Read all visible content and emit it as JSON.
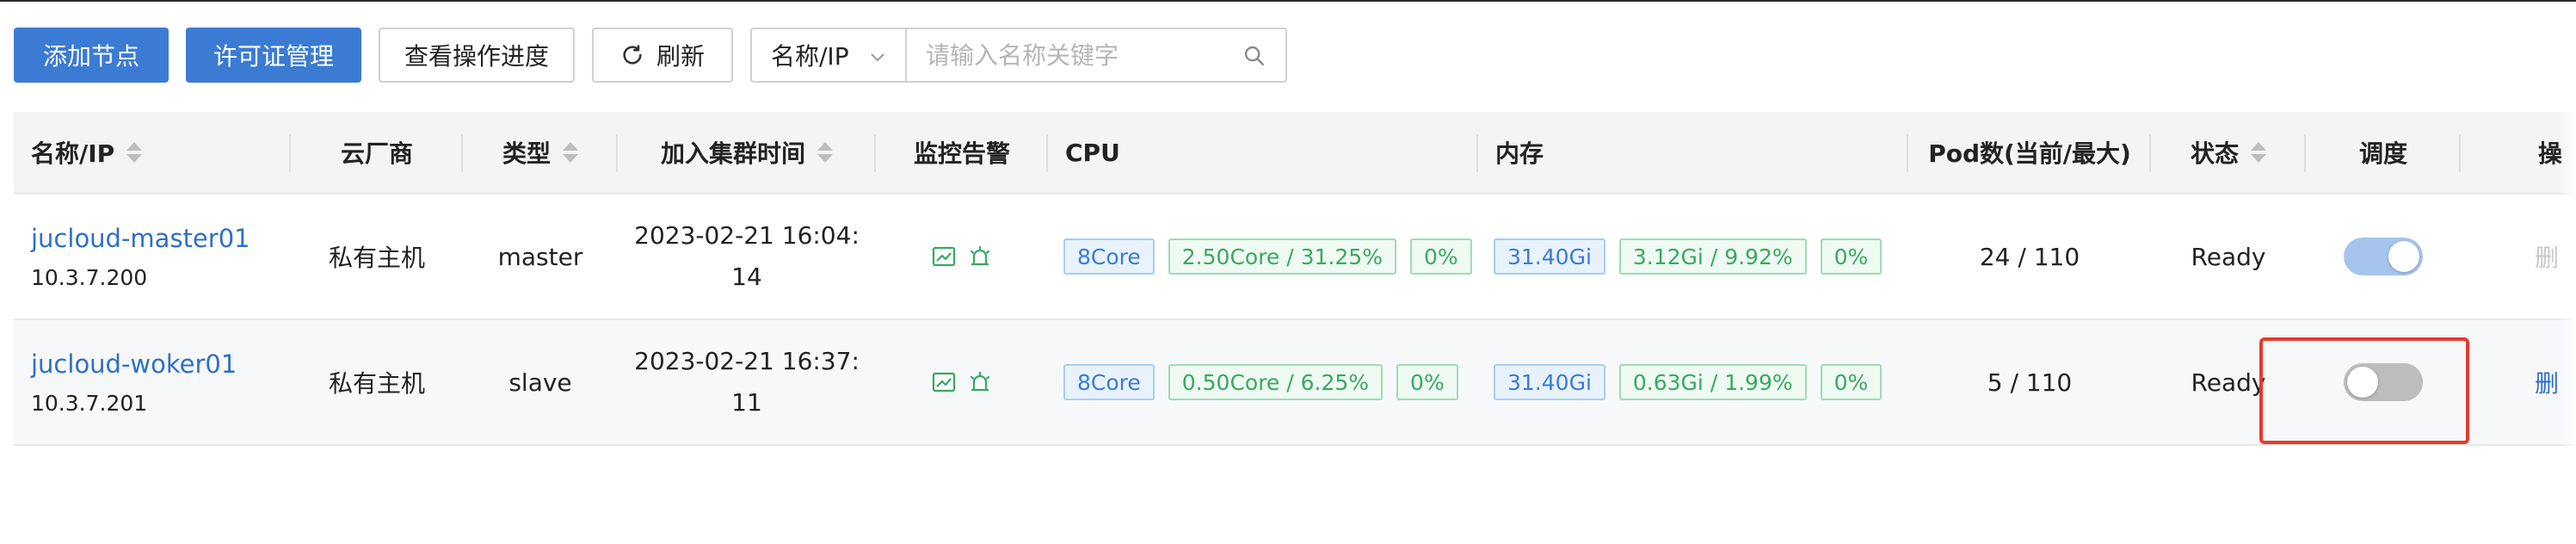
{
  "toolbar": {
    "add_node": "添加节点",
    "license_mgmt": "许可证管理",
    "view_progress": "查看操作进度",
    "refresh": "刷新",
    "search_field": "名称/IP",
    "search_placeholder": "请输入名称关键字"
  },
  "columns": {
    "name": "名称/IP",
    "cloud": "云厂商",
    "type": "类型",
    "join_time": "加入集群时间",
    "monitor": "监控告警",
    "cpu": "CPU",
    "memory": "内存",
    "pods": "Pod数(当前/最大)",
    "status": "状态",
    "schedule": "调度",
    "action": "操"
  },
  "rows": [
    {
      "name": "jucloud-master01",
      "ip": "10.3.7.200",
      "cloud": "私有主机",
      "type": "master",
      "join_time_1": "2023-02-21 16:04:",
      "join_time_2": "14",
      "cpu_total": "8Core",
      "cpu_used": "2.50Core / 31.25%",
      "cpu_pct": "0%",
      "mem_total": "31.40Gi",
      "mem_used": "3.12Gi / 9.92%",
      "mem_pct": "0%",
      "pods": "24 / 110",
      "status": "Ready",
      "schedulable": true,
      "action": "删"
    },
    {
      "name": "jucloud-woker01",
      "ip": "10.3.7.201",
      "cloud": "私有主机",
      "type": "slave",
      "join_time_1": "2023-02-21 16:37:",
      "join_time_2": "11",
      "cpu_total": "8Core",
      "cpu_used": "0.50Core / 6.25%",
      "cpu_pct": "0%",
      "mem_total": "31.40Gi",
      "mem_used": "0.63Gi / 1.99%",
      "mem_pct": "0%",
      "pods": "5 / 110",
      "status": "Ready",
      "schedulable": false,
      "action": "删"
    }
  ],
  "colors": {
    "primary": "#3b7bd4",
    "link": "#2f6fc6",
    "tag_blue": "#3b7bd4",
    "tag_green": "#39a862",
    "highlight": "#e53b2c"
  },
  "icons": {
    "monitor": "chart-icon",
    "alarm": "alarm-icon",
    "refresh": "refresh-icon",
    "search": "search-icon"
  }
}
